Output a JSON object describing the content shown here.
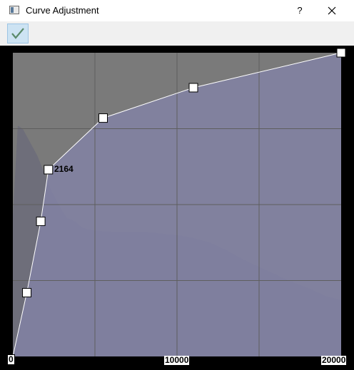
{
  "window": {
    "title": "Curve Adjustment",
    "help_label": "?",
    "close_icon": "close-icon",
    "app_icon": "app-window-icon"
  },
  "toolbar": {
    "confirm_icon": "checkmark-icon",
    "accent_color": "#5a8a6a"
  },
  "chart_data": {
    "type": "line",
    "xlim": [
      0,
      20000
    ],
    "ylim": [
      0,
      1
    ],
    "x_tick_labels": [
      "0",
      "10000",
      "20000"
    ],
    "grid": true,
    "colors": {
      "histogram_bg": "#7a7a7a",
      "histogram_fill": "#6e6e7a",
      "curve_fill": "#8282a6",
      "curve_line": "#ffffff",
      "grid_line": "#5e5e5e",
      "control_point": "#ffffff"
    },
    "control_points": [
      {
        "x": 0,
        "y": 0.0
      },
      {
        "x": 850,
        "y": 0.21
      },
      {
        "x": 1700,
        "y": 0.445
      },
      {
        "x": 2164,
        "y": 0.615
      },
      {
        "x": 5500,
        "y": 0.785
      },
      {
        "x": 11000,
        "y": 0.885
      },
      {
        "x": 20000,
        "y": 1.0
      }
    ],
    "selected_point_label": "2164",
    "histogram": [
      [
        0,
        0.46
      ],
      [
        300,
        0.76
      ],
      [
        600,
        0.75
      ],
      [
        900,
        0.72
      ],
      [
        1200,
        0.69
      ],
      [
        1500,
        0.66
      ],
      [
        1800,
        0.62
      ],
      [
        2100,
        0.58
      ],
      [
        2400,
        0.54
      ],
      [
        2700,
        0.51
      ],
      [
        3000,
        0.48
      ],
      [
        3300,
        0.455
      ],
      [
        3600,
        0.45
      ],
      [
        3900,
        0.44
      ],
      [
        4200,
        0.425
      ],
      [
        4500,
        0.42
      ],
      [
        5000,
        0.415
      ],
      [
        6000,
        0.41
      ],
      [
        7000,
        0.41
      ],
      [
        8000,
        0.41
      ],
      [
        9000,
        0.405
      ],
      [
        10000,
        0.4
      ],
      [
        11000,
        0.39
      ],
      [
        12000,
        0.375
      ],
      [
        13000,
        0.35
      ],
      [
        14000,
        0.32
      ],
      [
        15000,
        0.295
      ],
      [
        16000,
        0.27
      ],
      [
        17000,
        0.245
      ],
      [
        18000,
        0.225
      ],
      [
        19000,
        0.2
      ],
      [
        20000,
        0.185
      ]
    ]
  }
}
